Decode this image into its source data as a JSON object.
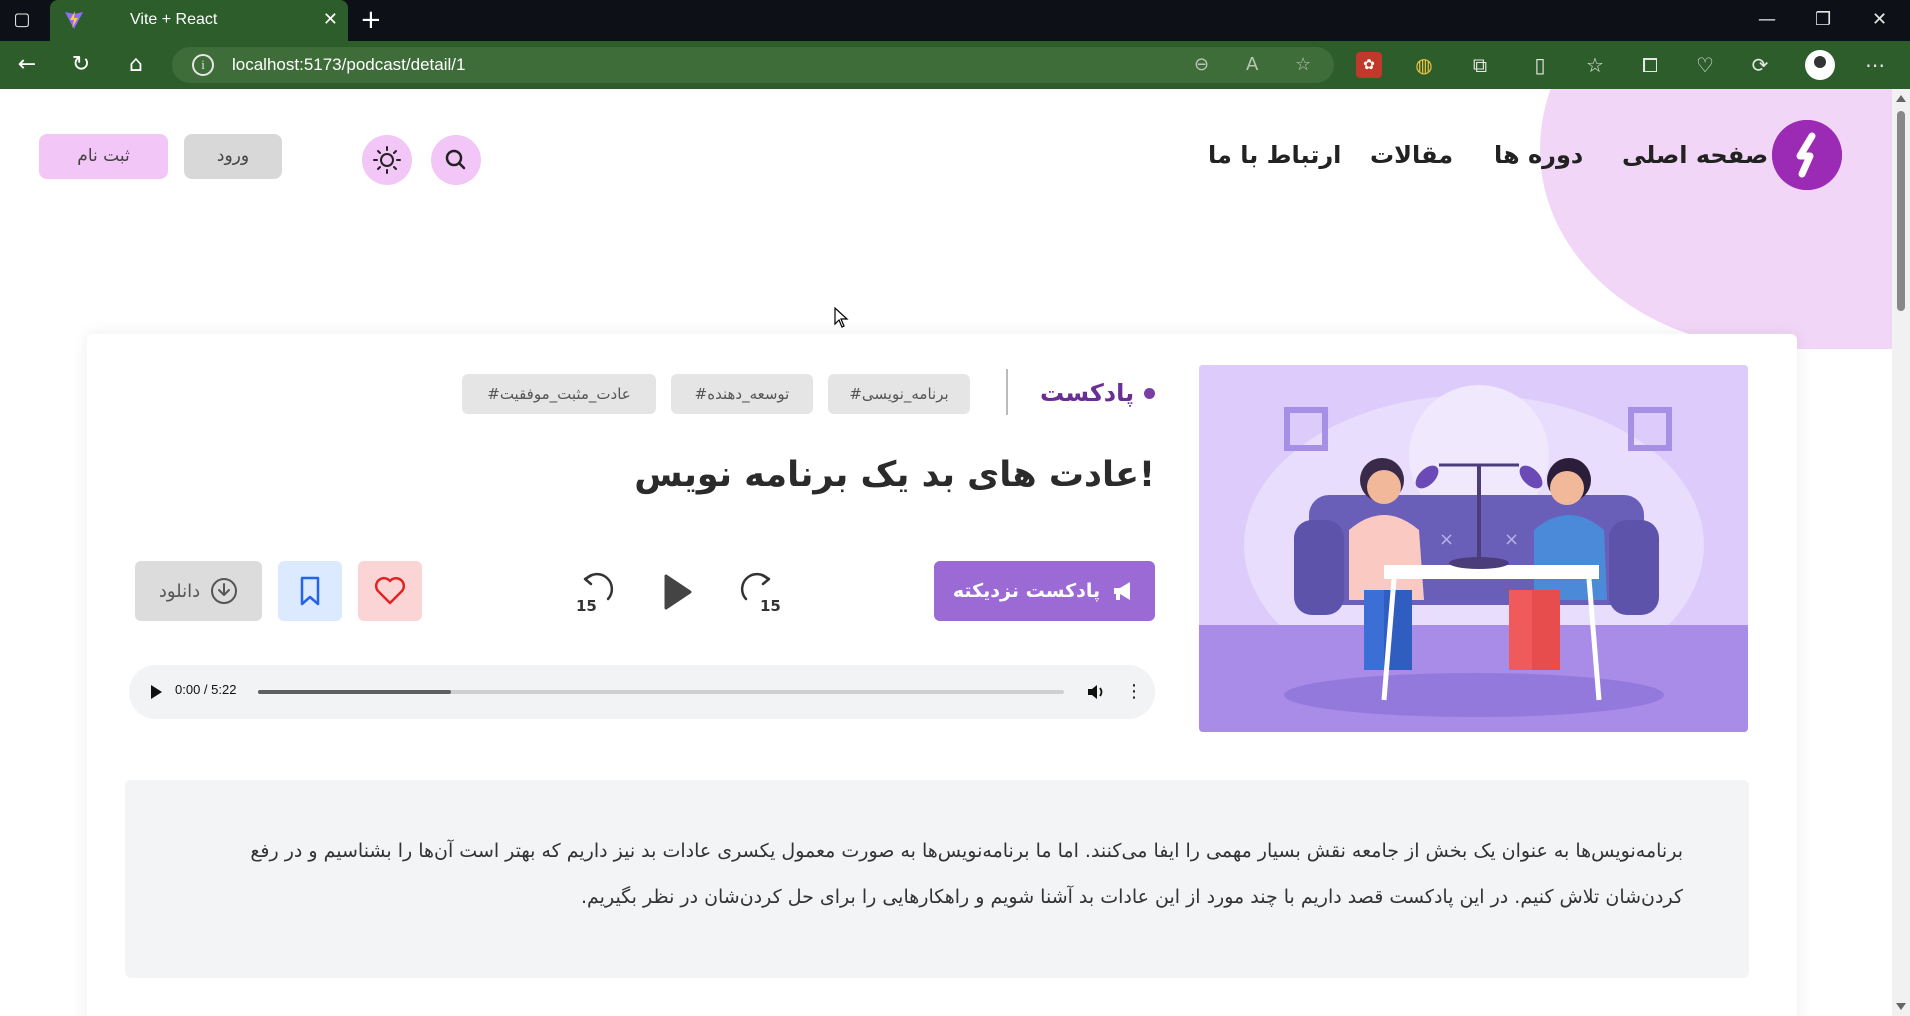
{
  "browser": {
    "tab_title": "Vite + React",
    "url": "localhost:5173/podcast/detail/1"
  },
  "header": {
    "nav": [
      "صفحه اصلی",
      "دوره ها",
      "مقالات",
      "ارتباط با ما"
    ],
    "login_label": "ورود",
    "signup_label": "ثبت نام"
  },
  "podcast": {
    "category": "پادکست",
    "tags": [
      "#برنامه_نویسی",
      "#توسعه_دهنده",
      "#عادت_مثبت_موفقیت"
    ],
    "title": "عادت های بد یک برنامه نویس!",
    "related_label": "پادکست نزدیکته",
    "skip_back": "15",
    "skip_forward": "15",
    "download_label": "دانلود",
    "player": {
      "time": "0:00 / 5:22",
      "progress": 0.24
    },
    "description": "برنامه‌نویس‌ها به عنوان یک بخش از جامعه نقش بسیار مهمی را ایفا می‌کنند. اما ما برنامه‌نویس‌ها به صورت معمول یکسری عادات بد نیز داریم که بهتر است آن‌ها را بشناسیم و در رفع کردن‌شان تلاش کنیم. در این پادکست قصد داریم با چند مورد از این عادات بد آشنا شویم و راهکارهایی را برای حل کردن‌شان در نظر بگیریم."
  },
  "colors": {
    "primary": "#9b2bb5",
    "accent_purple": "#9b6ad5",
    "pink_light": "#f2c6f6",
    "tab_green": "#2d5d2a"
  }
}
